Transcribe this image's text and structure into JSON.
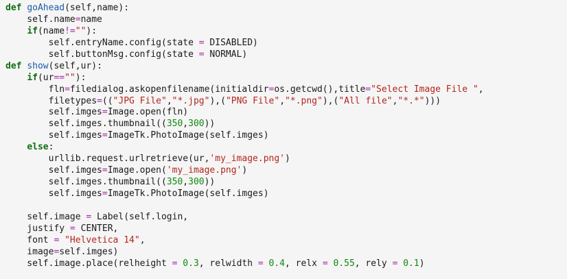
{
  "editor": {
    "colors": {
      "background": "#f5f5f5",
      "keyword": "#0f6e0f",
      "function_name": "#1e5aa8",
      "operator": "#a626a4",
      "string": "#b3261e",
      "number": "#0f8a0f",
      "plain": "#1a1a1a"
    },
    "lines": [
      [
        {
          "t": "kw",
          "v": "def"
        },
        {
          "t": "plain",
          "v": " "
        },
        {
          "t": "fn",
          "v": "goAhead"
        },
        {
          "t": "plain",
          "v": "(self,name):"
        }
      ],
      [
        {
          "t": "plain",
          "v": "    self.name"
        },
        {
          "t": "op",
          "v": "="
        },
        {
          "t": "plain",
          "v": "name"
        }
      ],
      [
        {
          "t": "plain",
          "v": "    "
        },
        {
          "t": "kw",
          "v": "if"
        },
        {
          "t": "plain",
          "v": "(name"
        },
        {
          "t": "op",
          "v": "!="
        },
        {
          "t": "str",
          "v": "\"\""
        },
        {
          "t": "plain",
          "v": "):"
        }
      ],
      [
        {
          "t": "plain",
          "v": "        self.entryName.config(state "
        },
        {
          "t": "op",
          "v": "="
        },
        {
          "t": "plain",
          "v": " DISABLED)"
        }
      ],
      [
        {
          "t": "plain",
          "v": "        self.buttonMsg.config(state "
        },
        {
          "t": "op",
          "v": "="
        },
        {
          "t": "plain",
          "v": " NORMAL)"
        }
      ],
      [
        {
          "t": "kw",
          "v": "def"
        },
        {
          "t": "plain",
          "v": " "
        },
        {
          "t": "fn",
          "v": "show"
        },
        {
          "t": "plain",
          "v": "(self,ur):"
        }
      ],
      [
        {
          "t": "plain",
          "v": "    "
        },
        {
          "t": "kw",
          "v": "if"
        },
        {
          "t": "plain",
          "v": "(ur"
        },
        {
          "t": "op",
          "v": "=="
        },
        {
          "t": "str",
          "v": "\"\""
        },
        {
          "t": "plain",
          "v": "):"
        }
      ],
      [
        {
          "t": "plain",
          "v": "        fln"
        },
        {
          "t": "op",
          "v": "="
        },
        {
          "t": "plain",
          "v": "filedialog.askopenfilename(initialdir"
        },
        {
          "t": "op",
          "v": "="
        },
        {
          "t": "plain",
          "v": "os.getcwd(),title"
        },
        {
          "t": "op",
          "v": "="
        },
        {
          "t": "str",
          "v": "\"Select Image File \""
        },
        {
          "t": "plain",
          "v": ","
        }
      ],
      [
        {
          "t": "plain",
          "v": "        filetypes"
        },
        {
          "t": "op",
          "v": "="
        },
        {
          "t": "plain",
          "v": "(("
        },
        {
          "t": "str",
          "v": "\"JPG File\""
        },
        {
          "t": "plain",
          "v": ","
        },
        {
          "t": "str",
          "v": "\"*.jpg\""
        },
        {
          "t": "plain",
          "v": "),("
        },
        {
          "t": "str",
          "v": "\"PNG File\""
        },
        {
          "t": "plain",
          "v": ","
        },
        {
          "t": "str",
          "v": "\"*.png\""
        },
        {
          "t": "plain",
          "v": "),("
        },
        {
          "t": "str",
          "v": "\"All file\""
        },
        {
          "t": "plain",
          "v": ","
        },
        {
          "t": "str",
          "v": "\"*.*\""
        },
        {
          "t": "plain",
          "v": ")))"
        }
      ],
      [
        {
          "t": "plain",
          "v": "        self.imges"
        },
        {
          "t": "op",
          "v": "="
        },
        {
          "t": "plain",
          "v": "Image.open(fln)"
        }
      ],
      [
        {
          "t": "plain",
          "v": "        self.imges.thumbnail(("
        },
        {
          "t": "num",
          "v": "350"
        },
        {
          "t": "plain",
          "v": ","
        },
        {
          "t": "num",
          "v": "300"
        },
        {
          "t": "plain",
          "v": "))"
        }
      ],
      [
        {
          "t": "plain",
          "v": "        self.imges"
        },
        {
          "t": "op",
          "v": "="
        },
        {
          "t": "plain",
          "v": "ImageTk.PhotoImage(self.imges)"
        }
      ],
      [
        {
          "t": "plain",
          "v": "    "
        },
        {
          "t": "kw",
          "v": "else"
        },
        {
          "t": "plain",
          "v": ":"
        }
      ],
      [
        {
          "t": "plain",
          "v": "        urllib.request.urlretrieve(ur,"
        },
        {
          "t": "str",
          "v": "'my_image.png'"
        },
        {
          "t": "plain",
          "v": ")"
        }
      ],
      [
        {
          "t": "plain",
          "v": "        self.imges"
        },
        {
          "t": "op",
          "v": "="
        },
        {
          "t": "plain",
          "v": "Image.open("
        },
        {
          "t": "str",
          "v": "'my_image.png'"
        },
        {
          "t": "plain",
          "v": ")"
        }
      ],
      [
        {
          "t": "plain",
          "v": "        self.imges.thumbnail(("
        },
        {
          "t": "num",
          "v": "350"
        },
        {
          "t": "plain",
          "v": ","
        },
        {
          "t": "num",
          "v": "300"
        },
        {
          "t": "plain",
          "v": "))"
        }
      ],
      [
        {
          "t": "plain",
          "v": "        self.imges"
        },
        {
          "t": "op",
          "v": "="
        },
        {
          "t": "plain",
          "v": "ImageTk.PhotoImage(self.imges)"
        }
      ],
      [],
      [
        {
          "t": "plain",
          "v": "    self.image "
        },
        {
          "t": "op",
          "v": "="
        },
        {
          "t": "plain",
          "v": " Label(self.login,"
        }
      ],
      [
        {
          "t": "plain",
          "v": "    justify "
        },
        {
          "t": "op",
          "v": "="
        },
        {
          "t": "plain",
          "v": " CENTER,"
        }
      ],
      [
        {
          "t": "plain",
          "v": "    font "
        },
        {
          "t": "op",
          "v": "="
        },
        {
          "t": "plain",
          "v": " "
        },
        {
          "t": "str",
          "v": "\"Helvetica 14\""
        },
        {
          "t": "plain",
          "v": ","
        }
      ],
      [
        {
          "t": "plain",
          "v": "    image"
        },
        {
          "t": "op",
          "v": "="
        },
        {
          "t": "plain",
          "v": "self.imges)"
        }
      ],
      [
        {
          "t": "plain",
          "v": "    self.image.place(relheight "
        },
        {
          "t": "op",
          "v": "="
        },
        {
          "t": "plain",
          "v": " "
        },
        {
          "t": "num",
          "v": "0.3"
        },
        {
          "t": "plain",
          "v": ", relwidth "
        },
        {
          "t": "op",
          "v": "="
        },
        {
          "t": "plain",
          "v": " "
        },
        {
          "t": "num",
          "v": "0.4"
        },
        {
          "t": "plain",
          "v": ", relx "
        },
        {
          "t": "op",
          "v": "="
        },
        {
          "t": "plain",
          "v": " "
        },
        {
          "t": "num",
          "v": "0.55"
        },
        {
          "t": "plain",
          "v": ", rely "
        },
        {
          "t": "op",
          "v": "="
        },
        {
          "t": "plain",
          "v": " "
        },
        {
          "t": "num",
          "v": "0.1"
        },
        {
          "t": "plain",
          "v": ")"
        }
      ]
    ]
  }
}
